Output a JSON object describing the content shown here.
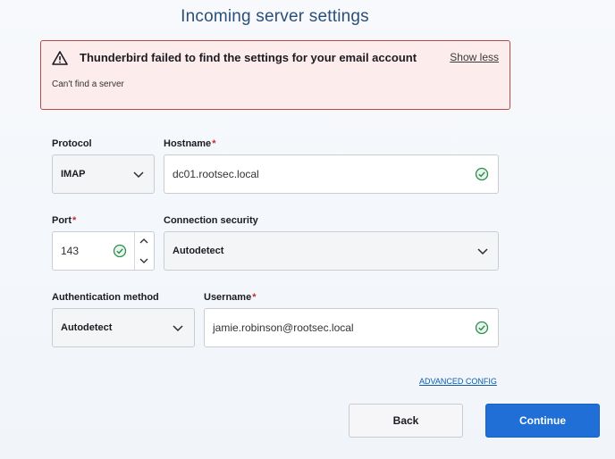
{
  "page": {
    "title": "Incoming server settings"
  },
  "error": {
    "title": "Thunderbird failed to find the settings for your email account",
    "toggle_label": "Show less",
    "detail": "Can't find a server"
  },
  "protocol": {
    "label": "Protocol",
    "value": "IMAP"
  },
  "hostname": {
    "label": "Hostname",
    "required_mark": "*",
    "value": "dc01.rootsec.local",
    "valid": true
  },
  "port": {
    "label": "Port",
    "required_mark": "*",
    "value": "143",
    "valid": true
  },
  "connection_security": {
    "label": "Connection security",
    "value": "Autodetect"
  },
  "authentication": {
    "label": "Authentication method",
    "value": "Autodetect"
  },
  "username": {
    "label": "Username",
    "required_mark": "*",
    "value": "jamie.robinson@rootsec.local",
    "valid": true
  },
  "links": {
    "advanced_config": "ADVANCED CONFIG"
  },
  "buttons": {
    "back": "Back",
    "continue": "Continue"
  },
  "colors": {
    "accent": "#1f6fd6",
    "error_border": "#b84a4a",
    "error_bg": "#fdecec",
    "valid": "#2e8b4e"
  }
}
